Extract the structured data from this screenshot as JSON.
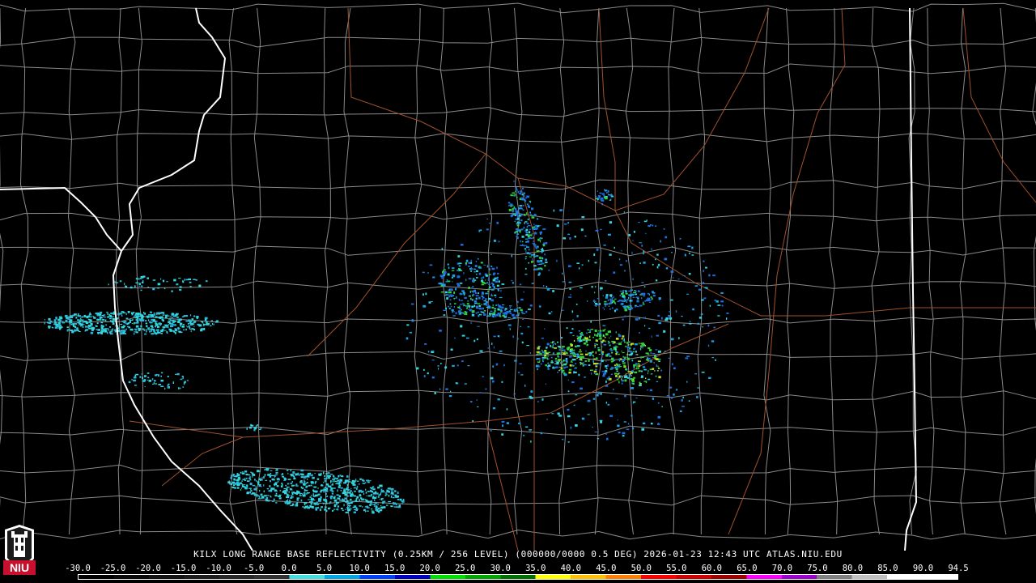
{
  "caption": "KILX LONG RANGE BASE REFLECTIVITY (0.25KM / 256 LEVEL) (000000/0000 0.5 DEG) 2026-01-23 12:43 UTC  ATLAS.NIU.EDU",
  "logo_text": "NIU",
  "legend": {
    "ticks": [
      "-30.0",
      "-25.0",
      "-20.0",
      "-15.0",
      "-10.0",
      "-5.0",
      "0.0",
      "5.0",
      "10.0",
      "15.0",
      "20.0",
      "25.0",
      "30.0",
      "35.0",
      "40.0",
      "45.0",
      "50.0",
      "55.0",
      "60.0",
      "65.0",
      "70.0",
      "75.0",
      "80.0",
      "85.0",
      "90.0",
      "94.5"
    ],
    "colors": [
      "#000000",
      "#0a0a0a",
      "#141414",
      "#1e1e1e",
      "#282828",
      "#323232",
      "#40e0e0",
      "#00a8e8",
      "#0040ff",
      "#0000c0",
      "#00e000",
      "#00a800",
      "#007000",
      "#ffff00",
      "#ffc000",
      "#ff8000",
      "#ff0000",
      "#d00000",
      "#a00000",
      "#ff00ff",
      "#a000d0",
      "#808080",
      "#c0c0c0",
      "#ffffff",
      "#ffffff"
    ]
  },
  "colors": {
    "background": "#000000",
    "county_lines": "#8a8a8a",
    "state_lines": "#ffffff",
    "roads": "#a0522d",
    "echo_low": "#33d6e0",
    "echo_mid": "#1f6fe0",
    "echo_high": "#2fd33a"
  }
}
